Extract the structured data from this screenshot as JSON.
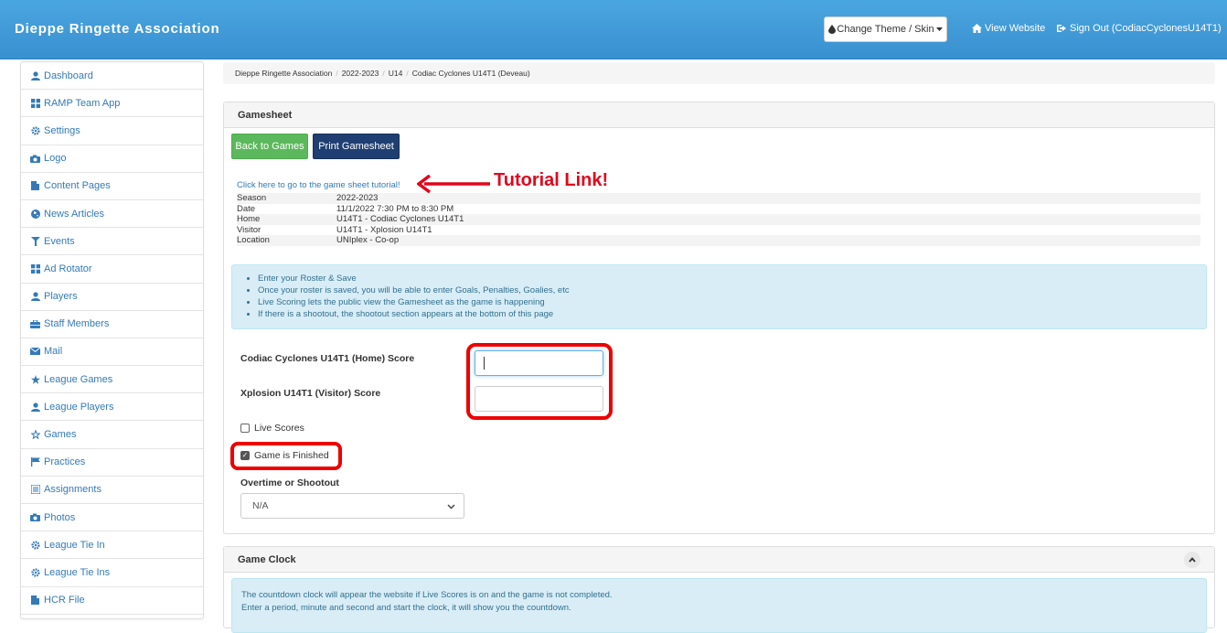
{
  "app": {
    "title": "Dieppe Ringette Association"
  },
  "header": {
    "theme_button": "Change Theme / Skin",
    "view_website": "View Website",
    "sign_out": "Sign Out (CodiacCyclonesU14T1)"
  },
  "sidebar": {
    "items": [
      {
        "label": "Dashboard",
        "icon": "user-icon"
      },
      {
        "label": "RAMP Team App",
        "icon": "grid-icon"
      },
      {
        "label": "Settings",
        "icon": "gear-icon"
      },
      {
        "label": "Logo",
        "icon": "camera-icon"
      },
      {
        "label": "Content Pages",
        "icon": "file-icon"
      },
      {
        "label": "News Articles",
        "icon": "globe-icon"
      },
      {
        "label": "Events",
        "icon": "filter-icon"
      },
      {
        "label": "Ad Rotator",
        "icon": "grid-icon"
      },
      {
        "label": "Players",
        "icon": "user-icon"
      },
      {
        "label": "Staff Members",
        "icon": "briefcase-icon"
      },
      {
        "label": "Mail",
        "icon": "envelope-icon"
      },
      {
        "label": "League Games",
        "icon": "star-icon"
      },
      {
        "label": "League Players",
        "icon": "user-icon"
      },
      {
        "label": "Games",
        "icon": "star-outline-icon"
      },
      {
        "label": "Practices",
        "icon": "flag-icon"
      },
      {
        "label": "Assignments",
        "icon": "list-icon"
      },
      {
        "label": "Photos",
        "icon": "camera-icon"
      },
      {
        "label": "League Tie In",
        "icon": "gear-icon"
      },
      {
        "label": "League Tie Ins",
        "icon": "gear-icon"
      },
      {
        "label": "HCR File",
        "icon": "file-icon"
      }
    ]
  },
  "breadcrumb": [
    "Dieppe Ringette Association",
    "2022-2023",
    "U14",
    "Codiac Cyclones U14T1 (Deveau)"
  ],
  "gamesheet": {
    "heading": "Gamesheet",
    "back_button": "Back to Games",
    "print_button": "Print Gamesheet",
    "tutorial_link": "Click here to go to the game sheet tutorial!",
    "tutorial_annotation": "Tutorial Link!",
    "info": [
      {
        "key": "Season",
        "value": "2022-2023"
      },
      {
        "key": "Date",
        "value": "11/1/2022 7:30 PM to 8:30 PM"
      },
      {
        "key": "Home",
        "value": "U14T1 - Codiac Cyclones U14T1"
      },
      {
        "key": "Visitor",
        "value": "U14T1 - Xplosion U14T1"
      },
      {
        "key": "Location",
        "value": "UNIplex - Co-op"
      }
    ],
    "instructions": [
      "Enter your Roster & Save",
      "Once your roster is saved, you will be able to enter Goals, Penalties, Goalies, etc",
      "Live Scoring lets the public view the Gamesheet as the game is happening",
      "If there is a shootout, the shootout section appears at the bottom of this page"
    ],
    "home_score_label": "Codiac Cyclones U14T1 (Home) Score",
    "visitor_score_label": "Xplosion U14T1 (Visitor) Score",
    "home_score_value": "",
    "visitor_score_value": "",
    "live_scores_label": "Live Scores",
    "live_scores_checked": false,
    "game_finished_label": "Game is Finished",
    "game_finished_checked": true,
    "overtime_label": "Overtime or Shootout",
    "overtime_value": "N/A"
  },
  "game_clock": {
    "heading": "Game Clock",
    "lines": [
      "The countdown clock will appear the website if Live Scores is on and the game is not completed.",
      "Enter a period, minute and second and start the clock, it will show you the countdown."
    ]
  },
  "colors": {
    "navbar": "#3d97d6",
    "link": "#337ab7",
    "success_button": "#5cb85c",
    "primary_button": "#1f3f73",
    "info_alert_bg": "#d9edf7",
    "highlight": "#e00000"
  }
}
